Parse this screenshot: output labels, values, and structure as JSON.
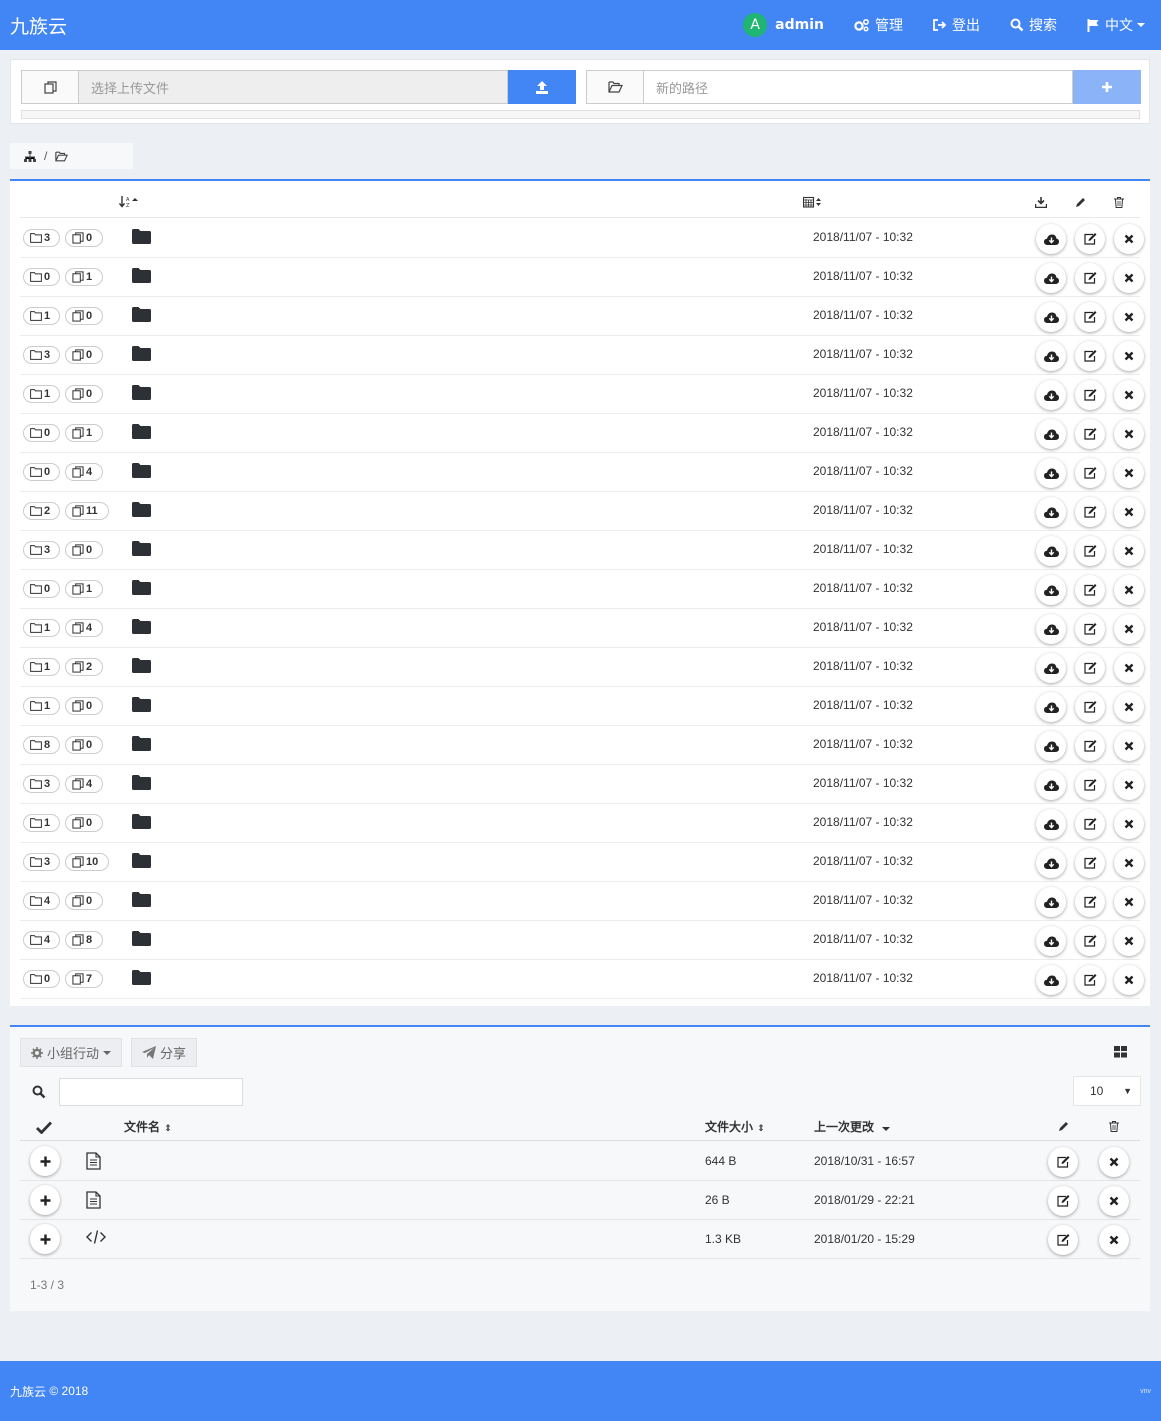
{
  "header": {
    "brand": "九族云",
    "avatar_letter": "A",
    "user": "admin",
    "admin_label": "管理",
    "logout_label": "登出",
    "search_label": "搜索",
    "lang_label": "中文"
  },
  "upload": {
    "file_placeholder": "选择上传文件",
    "path_placeholder": "新的路径"
  },
  "breadcrumb": {
    "separator": "/"
  },
  "folders": [
    {
      "dirs": "3",
      "files": "0",
      "date": "2018/11/07 - 10:32"
    },
    {
      "dirs": "0",
      "files": "1",
      "date": "2018/11/07 - 10:32"
    },
    {
      "dirs": "1",
      "files": "0",
      "date": "2018/11/07 - 10:32"
    },
    {
      "dirs": "3",
      "files": "0",
      "date": "2018/11/07 - 10:32"
    },
    {
      "dirs": "1",
      "files": "0",
      "date": "2018/11/07 - 10:32"
    },
    {
      "dirs": "0",
      "files": "1",
      "date": "2018/11/07 - 10:32"
    },
    {
      "dirs": "0",
      "files": "4",
      "date": "2018/11/07 - 10:32"
    },
    {
      "dirs": "2",
      "files": "11",
      "date": "2018/11/07 - 10:32"
    },
    {
      "dirs": "3",
      "files": "0",
      "date": "2018/11/07 - 10:32"
    },
    {
      "dirs": "0",
      "files": "1",
      "date": "2018/11/07 - 10:32"
    },
    {
      "dirs": "1",
      "files": "4",
      "date": "2018/11/07 - 10:32"
    },
    {
      "dirs": "1",
      "files": "2",
      "date": "2018/11/07 - 10:32"
    },
    {
      "dirs": "1",
      "files": "0",
      "date": "2018/11/07 - 10:32"
    },
    {
      "dirs": "8",
      "files": "0",
      "date": "2018/11/07 - 10:32"
    },
    {
      "dirs": "3",
      "files": "4",
      "date": "2018/11/07 - 10:32"
    },
    {
      "dirs": "1",
      "files": "0",
      "date": "2018/11/07 - 10:32"
    },
    {
      "dirs": "3",
      "files": "10",
      "date": "2018/11/07 - 10:32"
    },
    {
      "dirs": "4",
      "files": "0",
      "date": "2018/11/07 - 10:32"
    },
    {
      "dirs": "4",
      "files": "8",
      "date": "2018/11/07 - 10:32"
    },
    {
      "dirs": "0",
      "files": "7",
      "date": "2018/11/07 - 10:32"
    }
  ],
  "files_panel": {
    "group_action_label": "小组行动",
    "share_label": "分享",
    "page_size": "10",
    "col_name": "文件名",
    "col_size": "文件大小",
    "col_modified": "上一次更改",
    "pager": "1-3 / 3",
    "files": [
      {
        "icon": "text-file-icon",
        "size": "644 B",
        "date": "2018/10/31 - 16:57"
      },
      {
        "icon": "text-file-icon",
        "size": "26 B",
        "date": "2018/01/29 - 22:21"
      },
      {
        "icon": "code-file-icon",
        "size": "1.3 KB",
        "date": "2018/01/20 - 15:29"
      }
    ]
  },
  "footer": {
    "brand": "九族云",
    "copyright": "© 2018",
    "version": "vnv"
  },
  "colors": {
    "primary": "#4285f4",
    "avatar": "#1fb573"
  }
}
